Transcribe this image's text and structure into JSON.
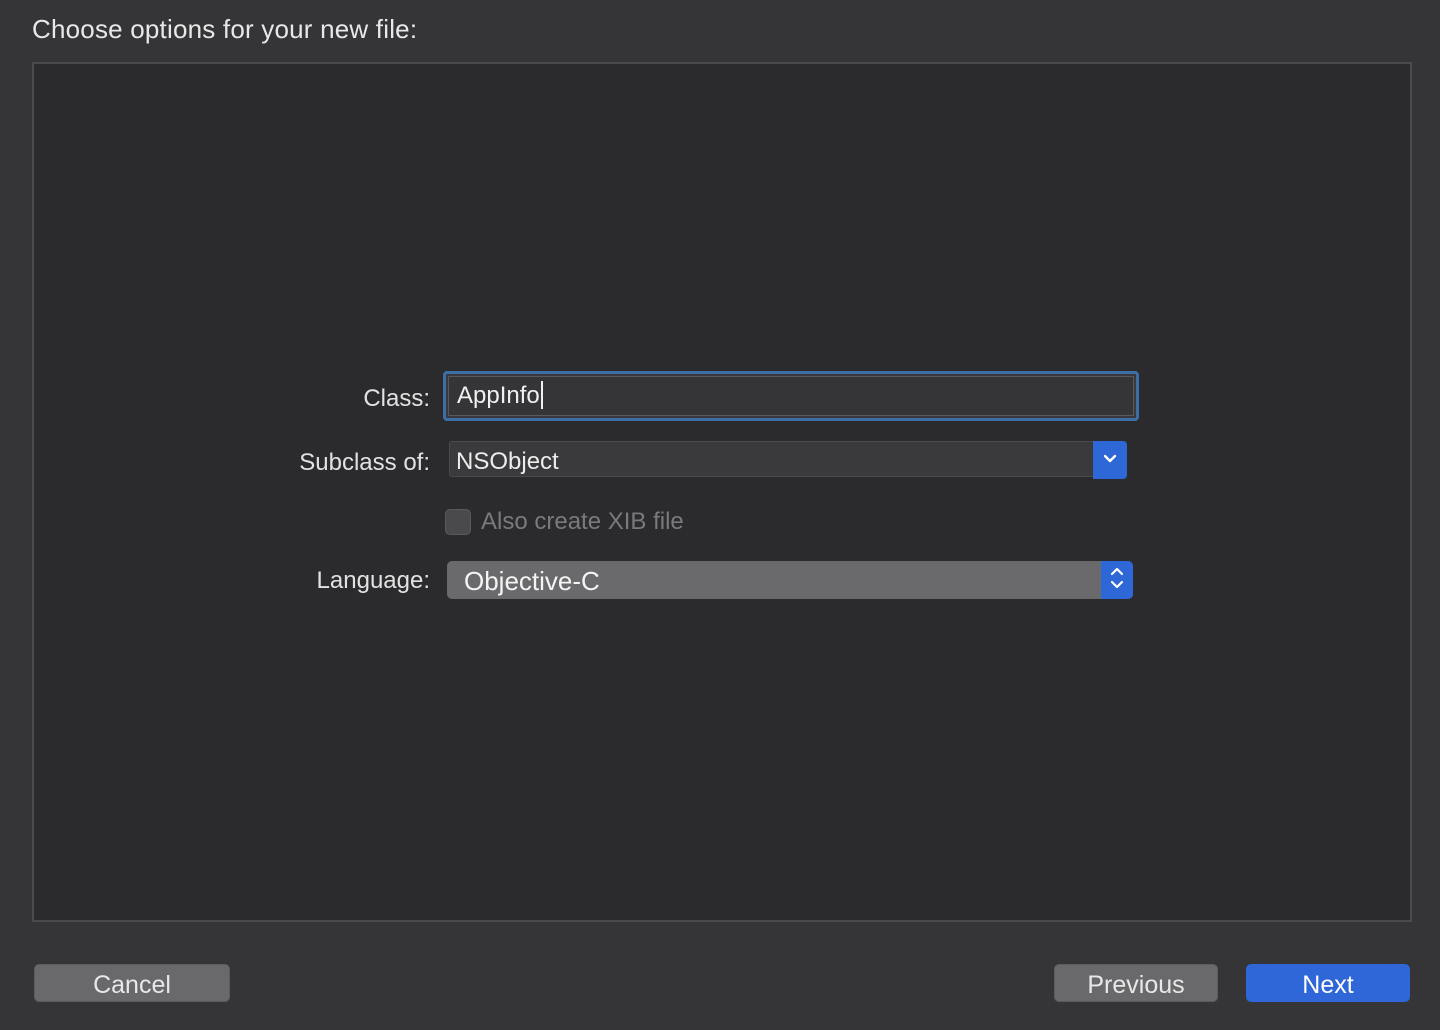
{
  "dialog": {
    "heading": "Choose options for your new file:"
  },
  "form": {
    "class_label": "Class:",
    "class_value": "AppInfo",
    "subclass_label": "Subclass of:",
    "subclass_value": "NSObject",
    "xib_checkbox_label": "Also create XIB file",
    "xib_checked": false,
    "language_label": "Language:",
    "language_value": "Objective-C"
  },
  "buttons": {
    "cancel": "Cancel",
    "previous": "Previous",
    "next": "Next"
  },
  "icons": {
    "combo_arrow": "chevron-down-icon",
    "popup_arrows": "up-down-chevrons-icon"
  },
  "colors": {
    "accent": "#2f67d8",
    "focus_ring": "#3d6ea5",
    "background": "#353538",
    "panel": "#2b2b2d"
  }
}
